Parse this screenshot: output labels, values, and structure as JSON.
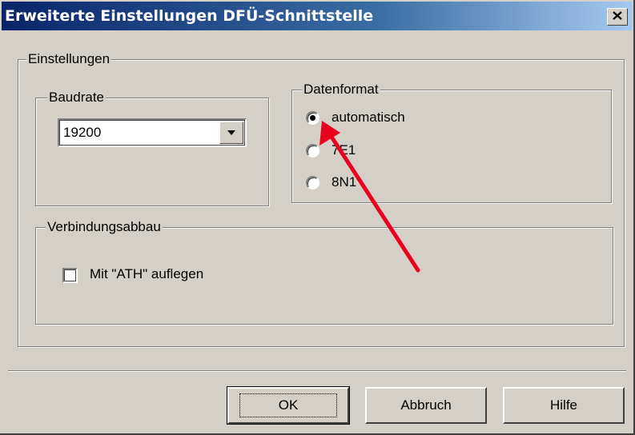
{
  "window": {
    "title": "Erweiterte Einstellungen DFÜ-Schnittstelle",
    "close_glyph": "✕"
  },
  "settings_group": {
    "label": "Einstellungen",
    "baudrate": {
      "label": "Baudrate",
      "selected_value": "19200"
    },
    "datenformat": {
      "label": "Datenformat",
      "options": [
        {
          "label": "automatisch",
          "checked": true
        },
        {
          "label": "7E1",
          "checked": false
        },
        {
          "label": "8N1",
          "checked": false
        }
      ]
    },
    "verbindungsabbau": {
      "label": "Verbindungsabbau",
      "checkbox_label": "Mit \"ATH\" auflegen",
      "checked": false
    }
  },
  "buttons": {
    "ok": "OK",
    "cancel": "Abbruch",
    "help": "Hilfe"
  },
  "colors": {
    "annotation_arrow": "#e8001c",
    "title_start": "#0a246a",
    "dialog_face": "#d4d0c8"
  }
}
